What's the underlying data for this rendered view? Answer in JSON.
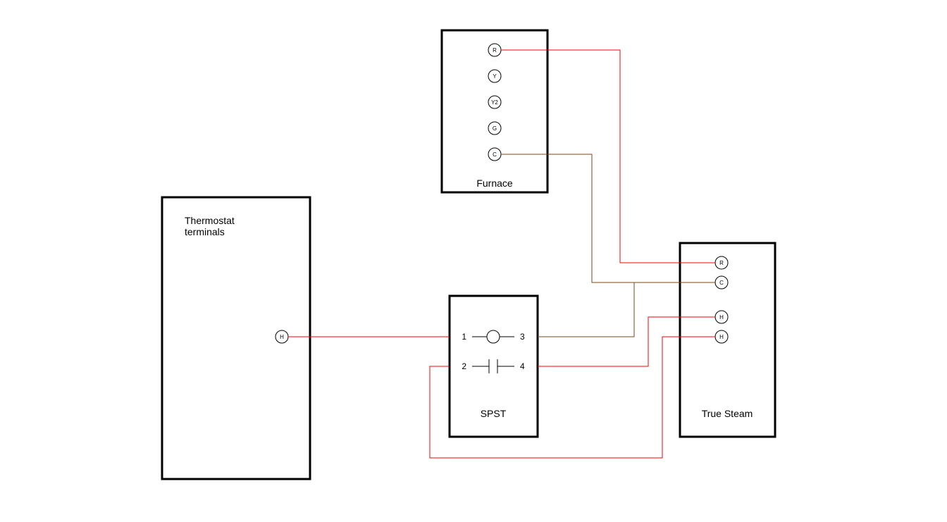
{
  "boxes": {
    "thermostat": {
      "label": "Thermostat\nterminals"
    },
    "furnace": {
      "label": "Furnace"
    },
    "spst": {
      "label": "SPST"
    },
    "truesteam": {
      "label": "True Steam"
    }
  },
  "furnace_terminals": [
    "R",
    "Y",
    "Y2",
    "G",
    "C"
  ],
  "thermostat_terminal": "H",
  "spst_pins": {
    "p1": "1",
    "p2": "2",
    "p3": "3",
    "p4": "4"
  },
  "truesteam_terminals": [
    "R",
    "C",
    "H",
    "H"
  ],
  "wire_colors": {
    "red": "#ff0000",
    "brown": "#7a4a1a"
  }
}
